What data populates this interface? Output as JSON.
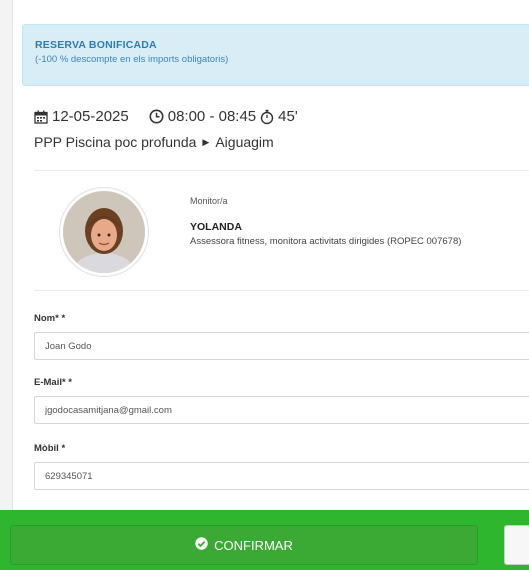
{
  "alert": {
    "title": "RESERVA BONIFICADA",
    "subtitle": "(-100 % descompte en els imports obligatoris)"
  },
  "session": {
    "date": "12-05-2025",
    "time": "08:00 - 08:45",
    "duration": "45'",
    "activity_area": "PPP Piscina poc profunda",
    "activity_name": "Aiguagim"
  },
  "monitor": {
    "label": "Monitor/a",
    "name": "YOLANDA",
    "description": "Assessora fitness, monitora activitats dirigides (ROPEC 007678)"
  },
  "form": {
    "name_label": "Nom* *",
    "name_value": "Joan Godo",
    "email_label": "E-Mail* *",
    "email_value": "jgodocasamitjana@gmail.com",
    "mobile_label": "Mòbil *",
    "mobile_value": "629345071"
  },
  "footer": {
    "confirm_label": "CONFIRMAR"
  },
  "icons": {
    "date": "calendar-icon",
    "time": "clock-icon",
    "duration": "stopwatch-icon",
    "separator": "caret-right-icon",
    "confirm": "check-circle-icon"
  },
  "colors": {
    "alert_bg": "#d9edf7",
    "alert_text": "#2f7cb0",
    "footer_bg": "#2fb62f",
    "confirm_bg": "#3aaa35"
  }
}
